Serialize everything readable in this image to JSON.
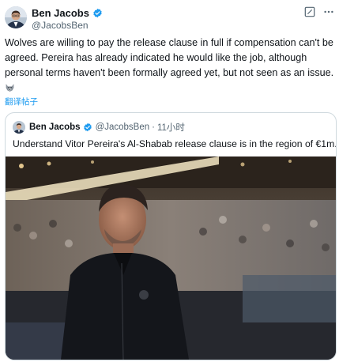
{
  "post": {
    "author_name": "Ben Jacobs",
    "author_handle": "@JacobsBen",
    "text": "Wolves are willing to pay the release clause in full if compensation can't be agreed. Pereira has already indicated he would like the job, although personal terms haven't been formally agreed yet, but not seen as an issue.",
    "emoji_icon": "wolf-emoji-icon",
    "translate_label": "翻译帖子"
  },
  "quote": {
    "author_name": "Ben Jacobs",
    "author_handle": "@JacobsBen",
    "time": "11小时",
    "separator": "·",
    "text": "Understand Vitor Pereira's Al-Shabab release clause is in the region of €1m.",
    "flag_icon": "portugal-flag-icon"
  },
  "colors": {
    "verified": "#1d9bf0",
    "link": "#1d9bf0",
    "secondary_text": "#536471",
    "border": "#cfd9de"
  }
}
